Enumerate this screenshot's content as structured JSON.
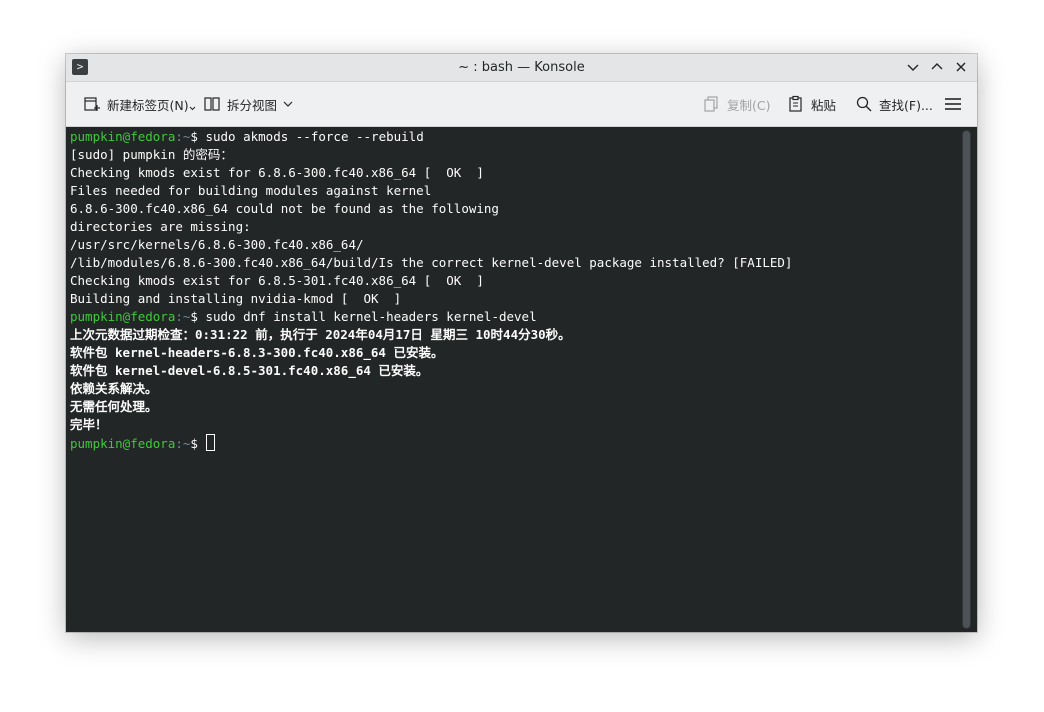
{
  "window": {
    "title": "~ : bash — Konsole"
  },
  "toolbar": {
    "new_tab": "新建标签页(N)",
    "split_view": "拆分视图",
    "copy": "复制(C)",
    "paste": "粘贴",
    "find": "查找(F)..."
  },
  "terminal": {
    "prompt_user": "pumpkin@fedora",
    "prompt_path": ":~",
    "prompt_symbol": "$",
    "lines": [
      {
        "type": "prompt",
        "cmd": " sudo akmods --force --rebuild"
      },
      {
        "type": "text",
        "text": "[sudo] pumpkin 的密码："
      },
      {
        "type": "text",
        "text": "Checking kmods exist for 6.8.6-300.fc40.x86_64 [  OK  ]"
      },
      {
        "type": "text",
        "text": "Files needed for building modules against kernel"
      },
      {
        "type": "text",
        "text": "6.8.6-300.fc40.x86_64 could not be found as the following"
      },
      {
        "type": "text",
        "text": "directories are missing:"
      },
      {
        "type": "text",
        "text": "/usr/src/kernels/6.8.6-300.fc40.x86_64/"
      },
      {
        "type": "text",
        "text": "/lib/modules/6.8.6-300.fc40.x86_64/build/Is the correct kernel-devel package installed? [FAILED]"
      },
      {
        "type": "text",
        "text": "Checking kmods exist for 6.8.5-301.fc40.x86_64 [  OK  ]"
      },
      {
        "type": "text",
        "text": "Building and installing nvidia-kmod [  OK  ]"
      },
      {
        "type": "prompt",
        "cmd": " sudo dnf install kernel-headers kernel-devel"
      },
      {
        "type": "bold",
        "text": "上次元数据过期检查：0:31:22 前，执行于 2024年04月17日 星期三 10时44分30秒。"
      },
      {
        "type": "bold",
        "text": "软件包 kernel-headers-6.8.3-300.fc40.x86_64 已安装。"
      },
      {
        "type": "bold",
        "text": "软件包 kernel-devel-6.8.5-301.fc40.x86_64 已安装。"
      },
      {
        "type": "bold",
        "text": "依赖关系解决。"
      },
      {
        "type": "bold",
        "text": "无需任何处理。"
      },
      {
        "type": "bold",
        "text": "完毕！"
      },
      {
        "type": "prompt",
        "cmd": " "
      }
    ]
  },
  "icons": {
    "app": "terminal-icon",
    "new_tab": "new-tab-icon",
    "split": "split-view-icon",
    "copy": "copy-icon",
    "paste": "paste-icon",
    "find": "search-icon",
    "menu": "hamburger-menu-icon"
  },
  "colors": {
    "terminal_bg": "#232627",
    "terminal_fg": "#fcfcfc",
    "prompt_user": "#3ec93a",
    "prompt_path": "#6a8aa6"
  }
}
